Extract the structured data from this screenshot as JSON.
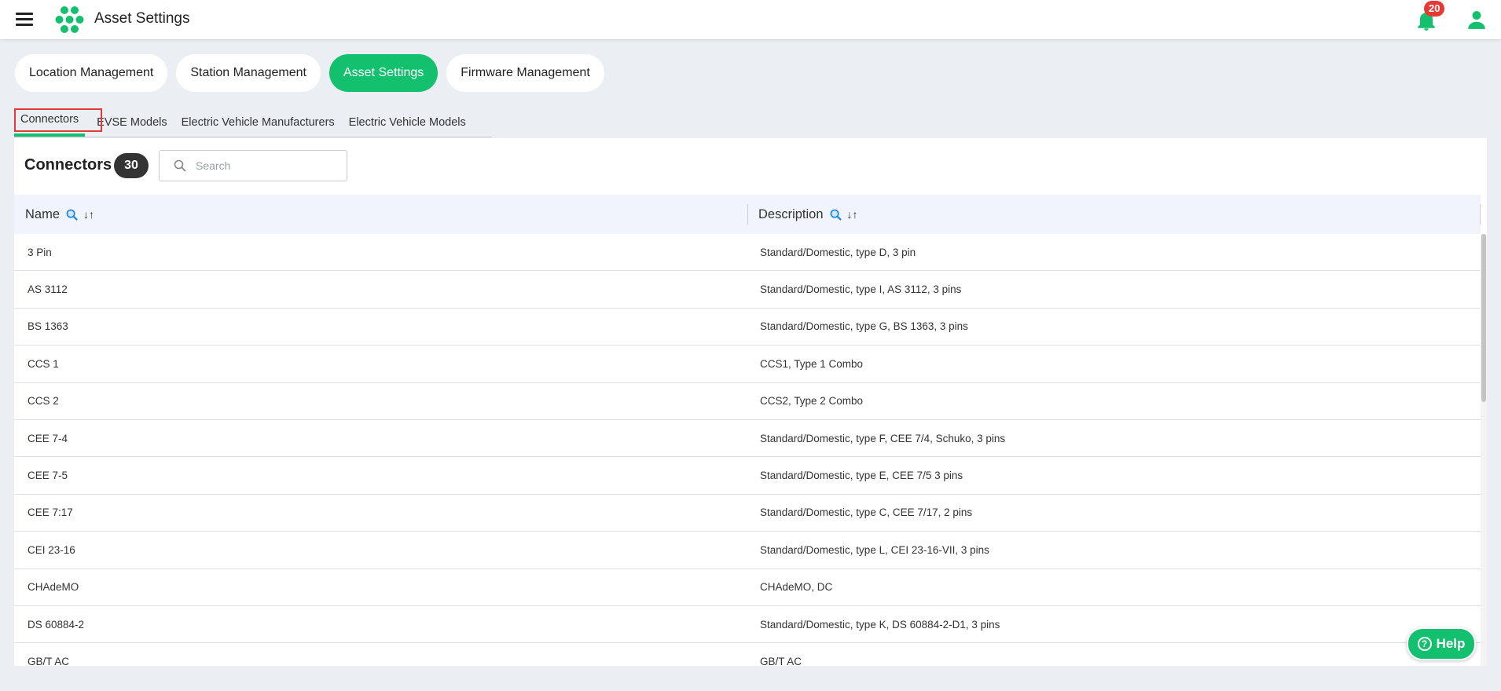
{
  "header": {
    "title": "Asset Settings",
    "notification_count": "20"
  },
  "main_tabs": [
    {
      "label": "Location Management"
    },
    {
      "label": "Station Management"
    },
    {
      "label": "Asset Settings"
    },
    {
      "label": "Firmware Management"
    }
  ],
  "sub_tabs": [
    {
      "label": "Connectors"
    },
    {
      "label": "EVSE Models"
    },
    {
      "label": "Electric Vehicle Manufacturers"
    },
    {
      "label": "Electric Vehicle Models"
    }
  ],
  "section": {
    "title": "Connectors",
    "count": "30",
    "search_placeholder": "Search"
  },
  "table": {
    "columns": [
      "Name",
      "Description"
    ],
    "sort_icon": "↓↑",
    "rows": [
      {
        "name": "3 Pin",
        "description": "Standard/Domestic, type D, 3 pin"
      },
      {
        "name": "AS 3112",
        "description": "Standard/Domestic, type I, AS 3112, 3 pins"
      },
      {
        "name": "BS 1363",
        "description": "Standard/Domestic, type G, BS 1363, 3 pins"
      },
      {
        "name": "CCS 1",
        "description": "CCS1, Type 1 Combo"
      },
      {
        "name": "CCS 2",
        "description": "CCS2, Type 2 Combo"
      },
      {
        "name": "CEE 7-4",
        "description": "Standard/Domestic, type F, CEE 7/4, Schuko, 3 pins"
      },
      {
        "name": "CEE 7-5",
        "description": "Standard/Domestic, type E, CEE 7/5 3 pins"
      },
      {
        "name": "CEE 7:17",
        "description": "Standard/Domestic, type C, CEE 7/17, 2 pins"
      },
      {
        "name": "CEI 23-16",
        "description": "Standard/Domestic, type L, CEI 23-16-VII, 3 pins"
      },
      {
        "name": "CHAdeMO",
        "description": "CHAdeMO, DC"
      },
      {
        "name": "DS 60884-2",
        "description": "Standard/Domestic, type K, DS 60884-2-D1, 3 pins"
      },
      {
        "name": "GB/T AC",
        "description": "GB/T AC"
      }
    ]
  },
  "help": {
    "label": "Help"
  },
  "colors": {
    "accent": "#13c06e",
    "badge": "#e53935",
    "highlight": "#e53935"
  }
}
